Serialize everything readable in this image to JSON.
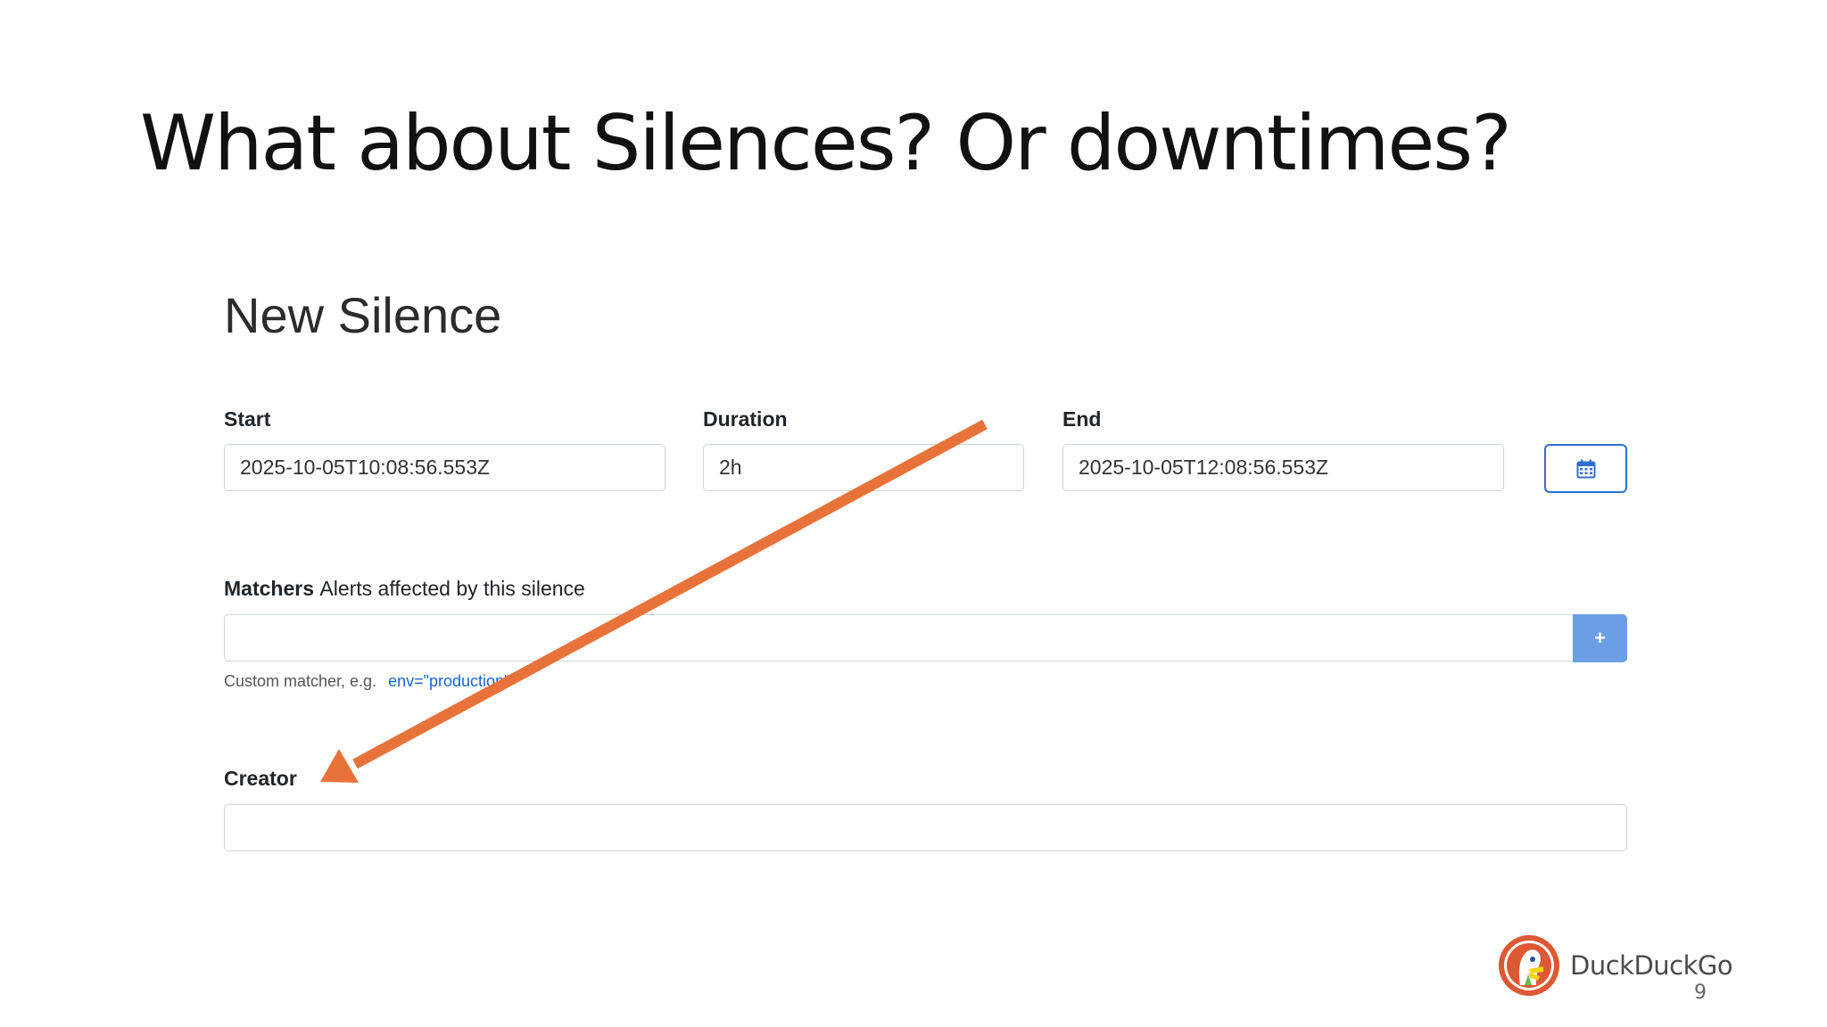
{
  "slide": {
    "title": "What about Silences? Or downtimes?",
    "page_number": "9",
    "brand": "DuckDuckGo"
  },
  "form": {
    "title": "New Silence",
    "start": {
      "label": "Start",
      "value": "2025-10-05T10:08:56.553Z"
    },
    "duration": {
      "label": "Duration",
      "value": "2h"
    },
    "end": {
      "label": "End",
      "value": "2025-10-05T12:08:56.553Z"
    },
    "calendar_icon": "calendar-icon",
    "matchers": {
      "label": "Matchers",
      "sublabel": "Alerts affected by this silence",
      "value": "",
      "add_label": "+",
      "help_text": "Custom matcher, e.g.",
      "help_example": "env=\"production\""
    },
    "creator": {
      "label": "Creator",
      "value": ""
    }
  },
  "annotation": {
    "color": "#e8733a"
  },
  "colors": {
    "primary": "#2f6fd1",
    "add_button": "#6c9ee6",
    "link": "#1a66cc"
  }
}
